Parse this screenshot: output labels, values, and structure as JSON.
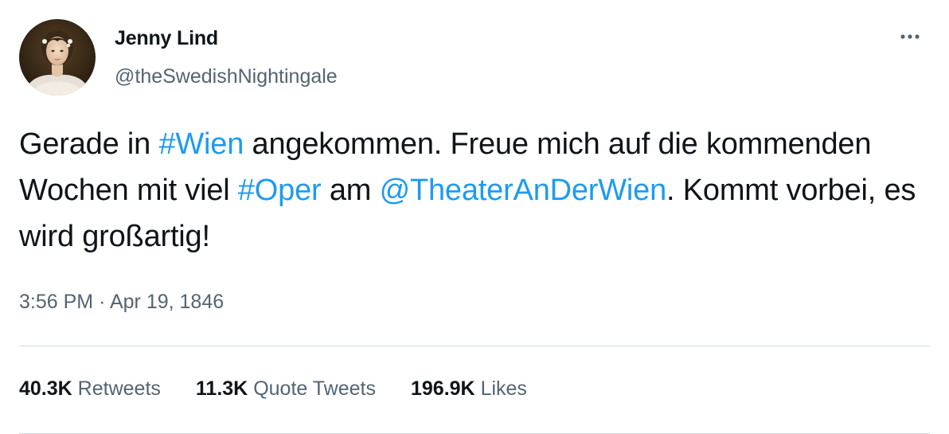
{
  "author": {
    "name": "Jenny Lind",
    "handle": "@theSwedishNightingale"
  },
  "tweet": {
    "segments": [
      {
        "text": "Gerade in ",
        "link": false
      },
      {
        "text": "#Wien",
        "link": true
      },
      {
        "text": " angekommen. Freue mich auf die kommenden Wochen mit viel ",
        "link": false
      },
      {
        "text": "#Oper",
        "link": true
      },
      {
        "text": " am ",
        "link": false
      },
      {
        "text": "@TheaterAnDerWien",
        "link": true
      },
      {
        "text": ". Kommt vorbei, es wird großartig!",
        "link": false
      }
    ],
    "time": "3:56 PM",
    "separator": "·",
    "date": "Apr 19, 1846"
  },
  "stats": {
    "retweets": {
      "count": "40.3K",
      "label": "Retweets"
    },
    "quotes": {
      "count": "11.3K",
      "label": "Quote Tweets"
    },
    "likes": {
      "count": "196.9K",
      "label": "Likes"
    }
  },
  "icons": {
    "more": "more-options-icon",
    "avatar": "avatar-portrait"
  },
  "colors": {
    "link": "#1d9bf0",
    "text": "#0f1419",
    "secondary": "#536471",
    "divider": "#cfd9de"
  }
}
